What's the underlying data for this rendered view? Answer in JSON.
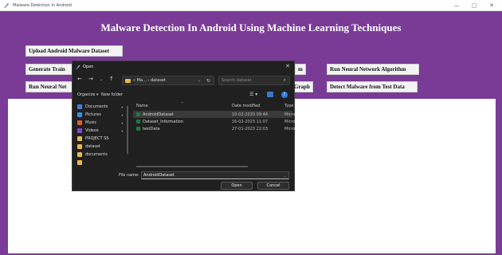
{
  "window": {
    "title": "Malware Detection In Android",
    "minimize_glyph": "—",
    "maximize_glyph": "▢",
    "close_glyph": "✕"
  },
  "app": {
    "heading": "Malware Detection In Android Using Machine Learning Techniques",
    "buttons": {
      "upload": "Upload Android Malware Dataset",
      "generate": "Generate Train",
      "nn_partial": "m",
      "run_nn": "Run Neural Network Algorithm",
      "run_nn2": "Run Neural Net",
      "graph_partial": "Graph",
      "detect": "Detect Malware from Test Data"
    },
    "colors": {
      "background": "#7a3b96",
      "button": "#f4f4f4",
      "output": "#ffffff"
    }
  },
  "dialog": {
    "title": "Open",
    "close_glyph": "✕",
    "nav": {
      "back": "←",
      "forward": "→",
      "dropdown": "⌄",
      "up": "↑"
    },
    "address": {
      "path": "« Ma... › dataset",
      "dropdown": "⌄",
      "refresh": "↻"
    },
    "search": {
      "placeholder": "Search dataset",
      "icon": "⌕"
    },
    "toolbar": {
      "organize": "Organize ▾",
      "new_folder": "New folder",
      "view": "☰ ▾",
      "help": "?"
    },
    "nav_pane": [
      {
        "label": "Documents",
        "color": "#4a7bd6",
        "pinned": true
      },
      {
        "label": "Pictures",
        "color": "#3a8ee0",
        "pinned": true
      },
      {
        "label": "Music",
        "color": "#e05a3a",
        "pinned": true
      },
      {
        "label": "Videos",
        "color": "#7a4ad6",
        "pinned": true
      },
      {
        "label": "PROJECT SS",
        "color": "#e8b84a",
        "pinned": false
      },
      {
        "label": "dataset",
        "color": "#e8b84a",
        "pinned": false
      },
      {
        "label": "documents",
        "color": "#e8b84a",
        "pinned": false
      },
      {
        "label": "",
        "color": "#e8b84a",
        "pinned": false
      }
    ],
    "pin_glyph": "📌",
    "columns": {
      "name": "Name",
      "date": "Date modified",
      "type": "Type",
      "sort_glyph": "^"
    },
    "files": [
      {
        "name": "AndroidDataset",
        "date": "10-02-2020 09:44",
        "type": "Micro",
        "selected": true
      },
      {
        "name": "Dataset_Information",
        "date": "16-02-2023 11:07",
        "type": "Micro",
        "selected": false
      },
      {
        "name": "testData",
        "date": "27-01-2023 22:03",
        "type": "Micro",
        "selected": false
      }
    ],
    "file_name_label": "File name:",
    "file_name_value": "AndroidDataset",
    "file_name_dropdown": "⌄",
    "open_label": "Open",
    "cancel_label": "Cancel"
  }
}
